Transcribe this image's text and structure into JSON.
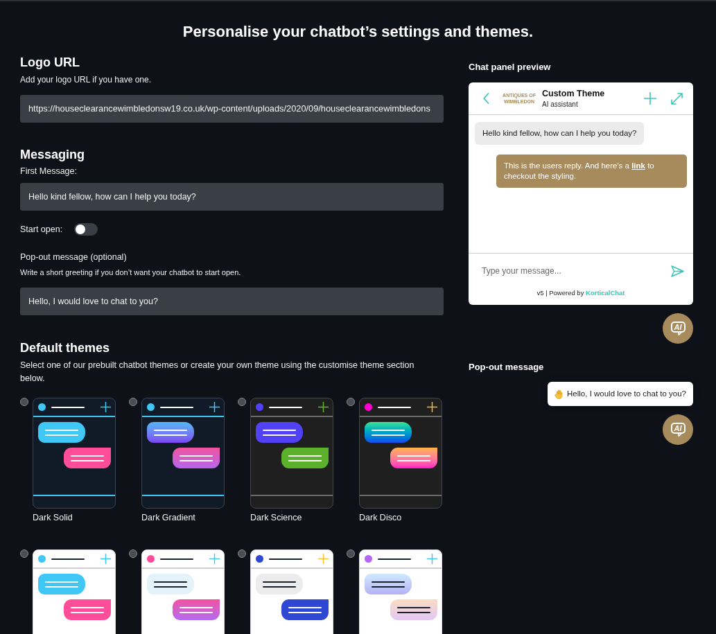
{
  "page": {
    "title": "Personalise your chatbot’s settings and themes."
  },
  "logo_url": {
    "heading": "Logo URL",
    "description": "Add your logo URL if you have one.",
    "value": "https://houseclearancewimbledonsw19.co.uk/wp-content/uploads/2020/09/houseclearancewimbledons"
  },
  "messaging": {
    "heading": "Messaging",
    "first_message": {
      "label": "First Message:",
      "value": "Hello kind fellow, how can I help you today?"
    },
    "start_open": {
      "label": "Start open:",
      "on": false
    },
    "popout_message": {
      "label": "Pop-out message (optional)",
      "hint": "Write a short greeting if you don’t want your chatbot to start open.",
      "value": "Hello, I would love to chat to you?"
    }
  },
  "default_themes": {
    "heading": "Default themes",
    "description": "Select one of our prebuilt chatbot themes or create your own theme using the customise theme section below.",
    "themes": [
      {
        "name": "Dark Solid",
        "selected": false,
        "color": "#3fc8f5"
      },
      {
        "name": "Dark Gradient",
        "selected": false,
        "color": "#3fc8f5"
      },
      {
        "name": "Dark Science",
        "selected": false,
        "color": "#5242f5"
      },
      {
        "name": "Dark Disco",
        "selected": false,
        "color": "#ff00d4"
      },
      {
        "selected": false,
        "color": "#3fc8f5"
      },
      {
        "selected": false,
        "color": "#ff4d9a"
      },
      {
        "selected": false,
        "color": "#2f48d4"
      },
      {
        "selected": false,
        "color": "#b466f5"
      }
    ]
  },
  "chat_preview": {
    "heading": "Chat panel preview",
    "logo_text": "ANTIQUES OF WIMBLEDON",
    "title": "Custom Theme",
    "subtitle": "AI assistant",
    "messages": [
      {
        "kind": "bot",
        "text": "Hello kind fellow, how can I help you today?"
      },
      {
        "kind": "user",
        "text": "This is the users reply. And here's a",
        "link": "link",
        "text_after": "to checkout the styling."
      }
    ],
    "input": {
      "placeholder": "Type your message..."
    },
    "footer": {
      "text": "v5 | Powered by",
      "brand": "KorticalChat"
    },
    "launcher": {
      "label": "AI"
    }
  },
  "popout_preview": {
    "heading": "Pop-out message",
    "message": "Hello, I would love to chat to you?",
    "launcher": {
      "label": "AI"
    }
  }
}
